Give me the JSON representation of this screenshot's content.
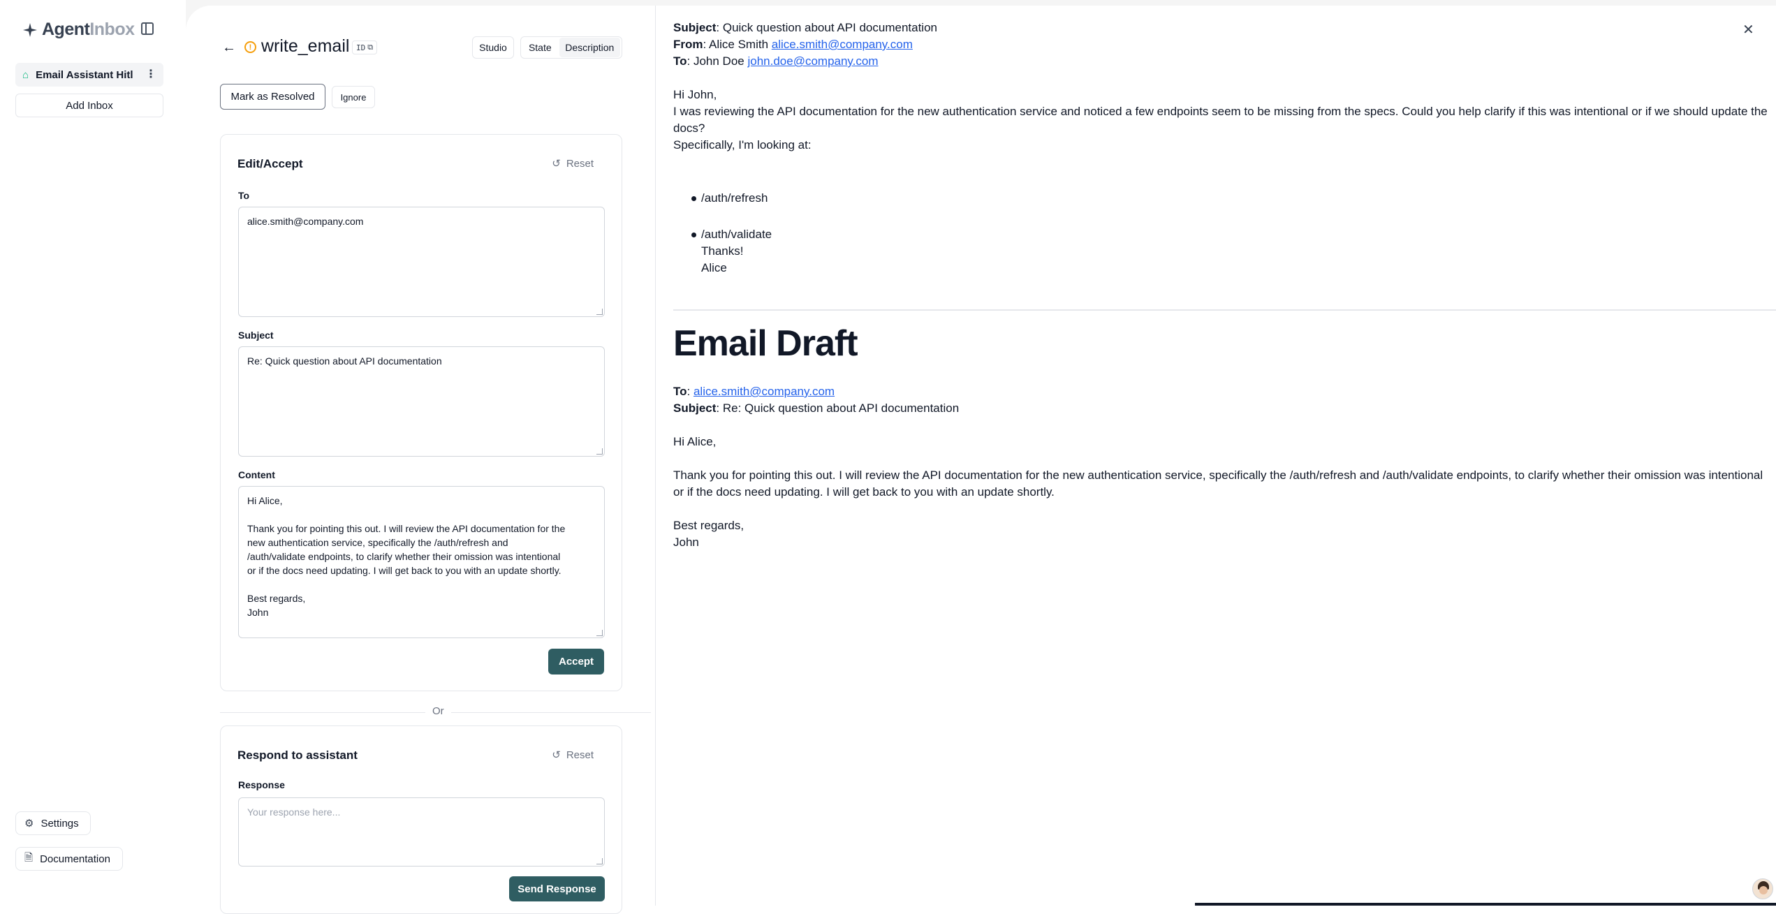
{
  "brand": {
    "name_main": "Agent",
    "name_muted": "Inbox"
  },
  "sidebar": {
    "inbox_label": "Email Assistant Hitl",
    "add_inbox": "Add Inbox",
    "settings": "Settings",
    "documentation": "Documentation"
  },
  "header": {
    "title": "write_email",
    "id_badge": "ID",
    "studio": "Studio",
    "tabs": [
      "State",
      "Description"
    ],
    "selected_tab": "Description"
  },
  "actions": {
    "resolve": "Mark as Resolved",
    "ignore": "Ignore"
  },
  "edit_panel": {
    "title": "Edit/Accept",
    "reset": "Reset",
    "to_label": "To",
    "to_value": "alice.smith@company.com",
    "subject_label": "Subject",
    "subject_value": "Re: Quick question about API documentation",
    "content_label": "Content",
    "content_value": "Hi Alice,\n\nThank you for pointing this out. I will review the API documentation for the\nnew authentication service, specifically the /auth/refresh and\n/auth/validate endpoints, to clarify whether their omission was intentional\nor if the docs need updating. I will get back to you with an update shortly.\n\nBest regards,\nJohn",
    "accept": "Accept"
  },
  "or_text": "Or",
  "respond_panel": {
    "title": "Respond to assistant",
    "reset": "Reset",
    "response_label": "Response",
    "placeholder": "Your response here...",
    "send": "Send Response"
  },
  "original_email": {
    "subject_label": "Subject",
    "subject": ": Quick question about API documentation",
    "from_label": "From",
    "from_name": ": Alice Smith ",
    "from_email": "alice.smith@company.com",
    "to_label": "To",
    "to_name": ": John Doe ",
    "to_email": "john.doe@company.com",
    "greeting": "Hi John,",
    "body_line1": "I was reviewing the API documentation for the new authentication service and noticed a few endpoints seem to be missing from the specs. Could you help clarify if this was intentional or if we should update the",
    "body_line2": "docs?",
    "body_line3": "Specifically, I'm looking at:",
    "bullets": [
      "/auth/refresh",
      "/auth/validate"
    ],
    "thanks": "Thanks!",
    "sign": "Alice"
  },
  "draft": {
    "heading": "Email Draft",
    "to_label": "To",
    "to_email": "alice.smith@company.com",
    "subject_label": "Subject",
    "subject": ": Re: Quick question about API documentation",
    "greeting": "Hi Alice,",
    "body_line1": "Thank you for pointing this out. I will review the API documentation for the new authentication service, specifically the /auth/refresh and /auth/validate endpoints, to clarify whether their omission was intentional",
    "body_line2": "or if the docs need updating. I will get back to you with an update shortly.",
    "closing": "Best regards,",
    "name": "John"
  },
  "colors": {
    "accent": "#2f5d62",
    "link": "#2563eb",
    "warning": "#f59e0b",
    "inbox_icon": "#10b981"
  },
  "icons": [
    "sparkle-logo-icon",
    "sidebar-toggle-icon",
    "home-icon",
    "more-vertical-icon",
    "settings-icon",
    "document-icon",
    "back-arrow-icon",
    "alert-circle-icon",
    "copy-icon",
    "reset-icon",
    "close-icon"
  ]
}
